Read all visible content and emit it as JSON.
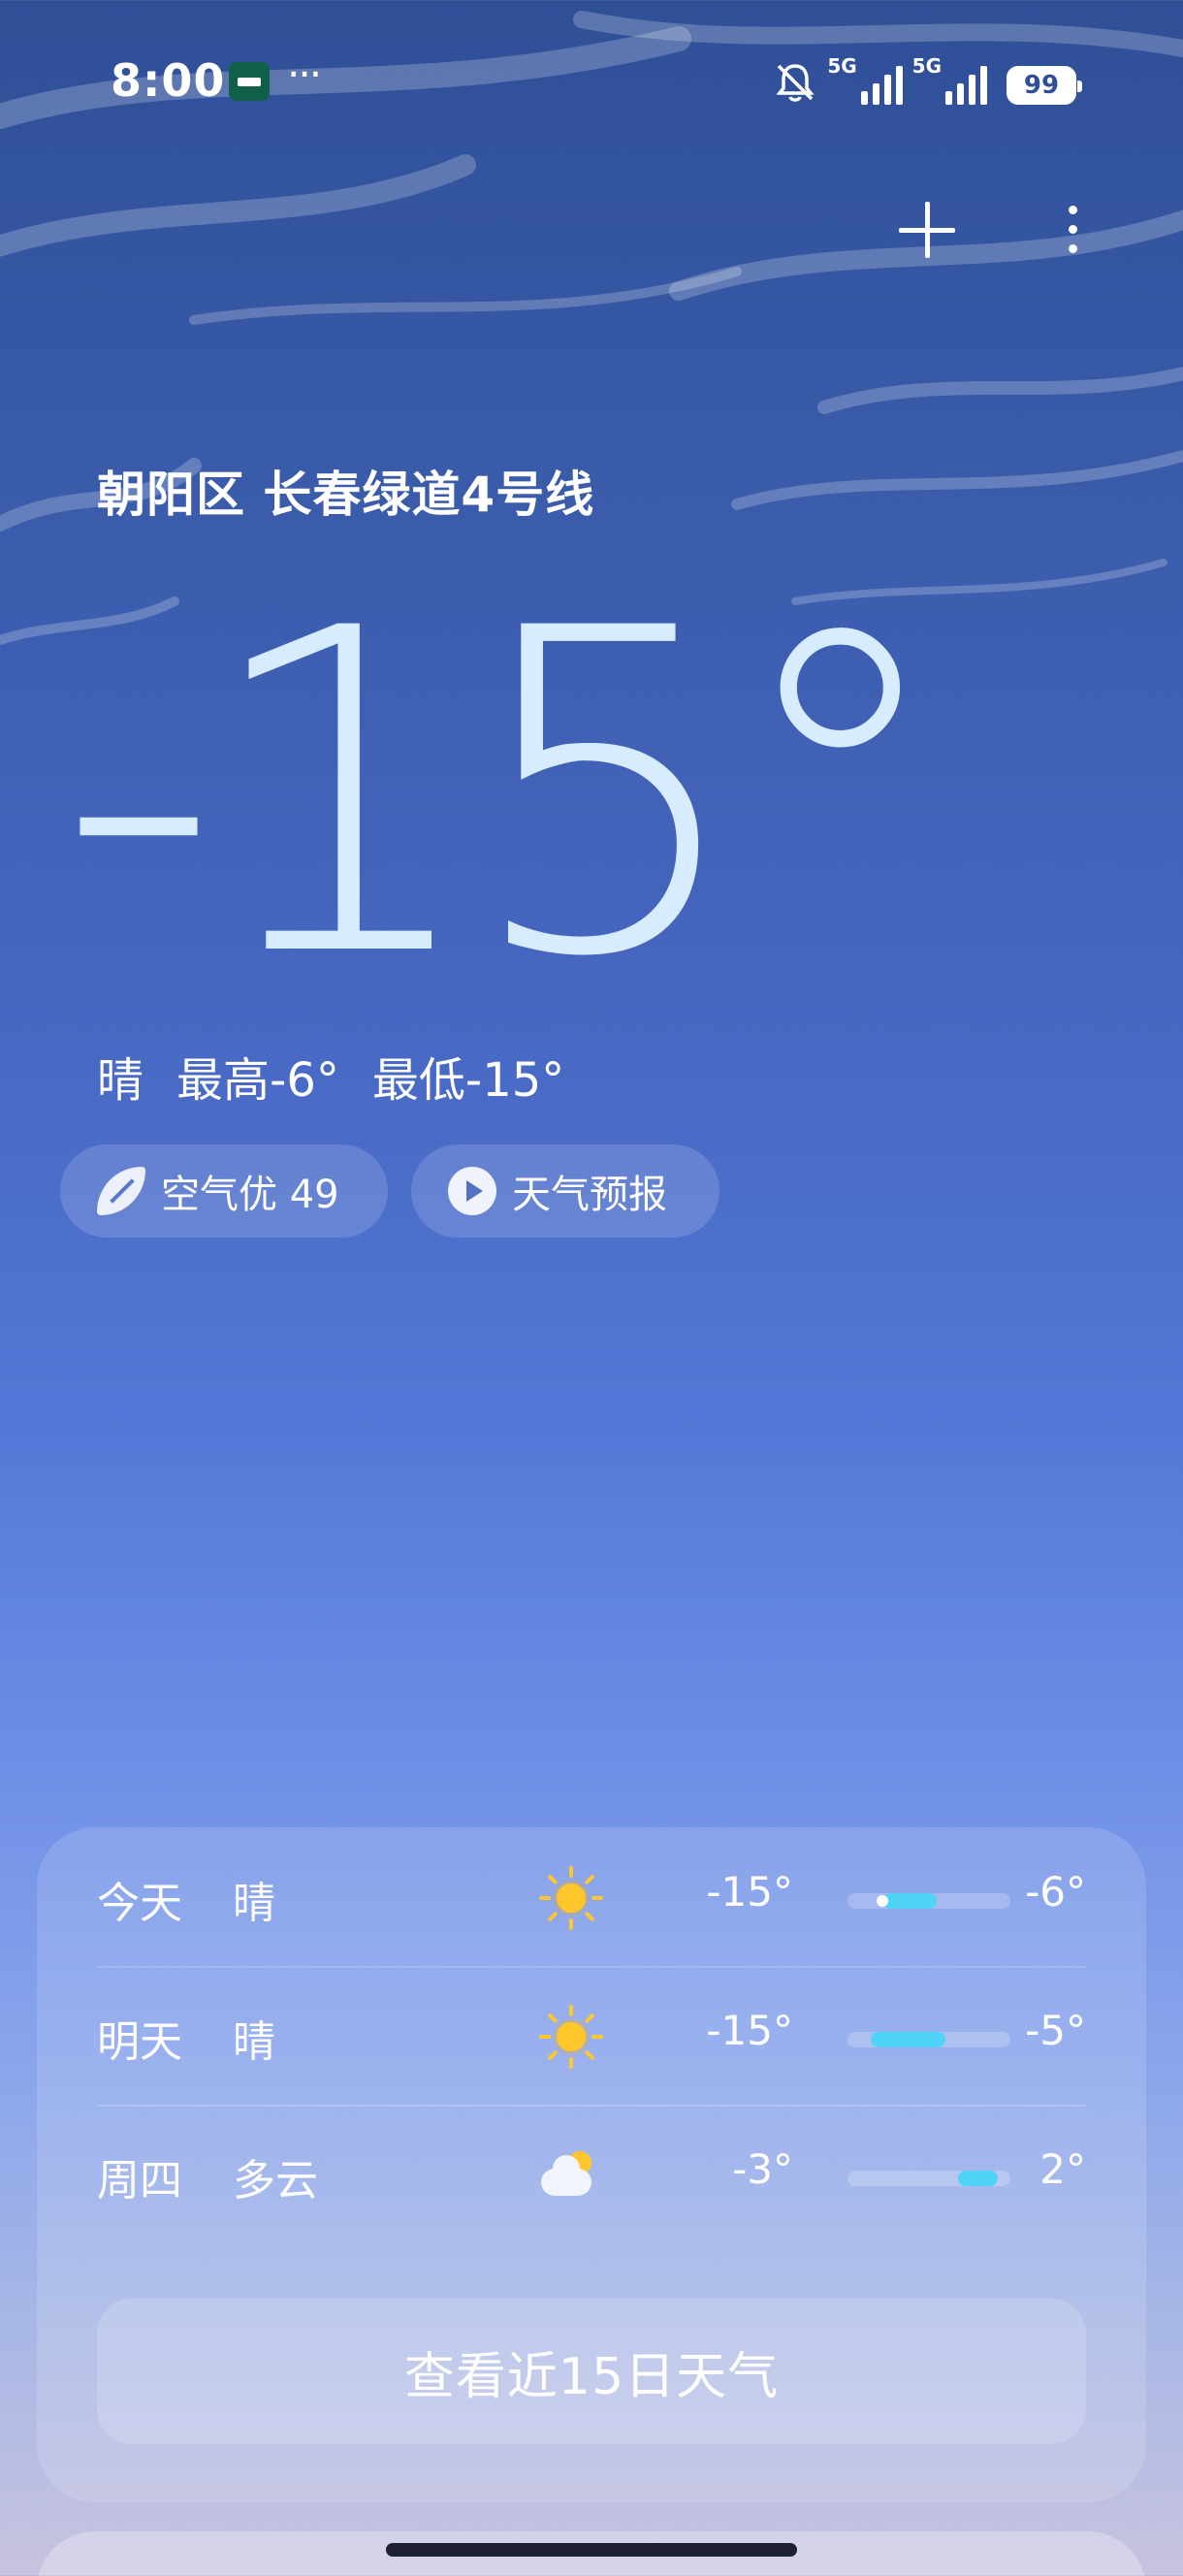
{
  "status_bar": {
    "time": "8:00",
    "app_icon": "notification-app-icon",
    "more_indicator": "···",
    "network1": "5G",
    "network2": "5G",
    "battery": "99",
    "icons": [
      "bell-muted-icon",
      "signal-icon",
      "battery-icon"
    ]
  },
  "toolbar": {
    "add_icon": "plus-icon",
    "more_icon": "more-vertical-icon"
  },
  "location": "朝阳区 长春绿道4号线",
  "current": {
    "temperature": "-15°",
    "condition": "晴",
    "high": "最高-6°",
    "low": "最低-15°"
  },
  "chips": {
    "air_quality": "空气优 49",
    "forecast": "天气预报"
  },
  "forecast": {
    "rows": [
      {
        "day": "今天",
        "condition": "晴",
        "icon": "sun-icon",
        "low": "-15°",
        "high": "-6°",
        "range_start": 0.22,
        "range_end": 0.55
      },
      {
        "day": "明天",
        "condition": "晴",
        "icon": "sun-icon",
        "low": "-15°",
        "high": "-5°",
        "range_start": 0.14,
        "range_end": 0.6
      },
      {
        "day": "周四",
        "condition": "多云",
        "icon": "partly-cloudy-icon",
        "low": "-3°",
        "high": "2°",
        "range_start": 0.68,
        "range_end": 0.92
      }
    ],
    "view_15_days": "查看近15日天气"
  }
}
